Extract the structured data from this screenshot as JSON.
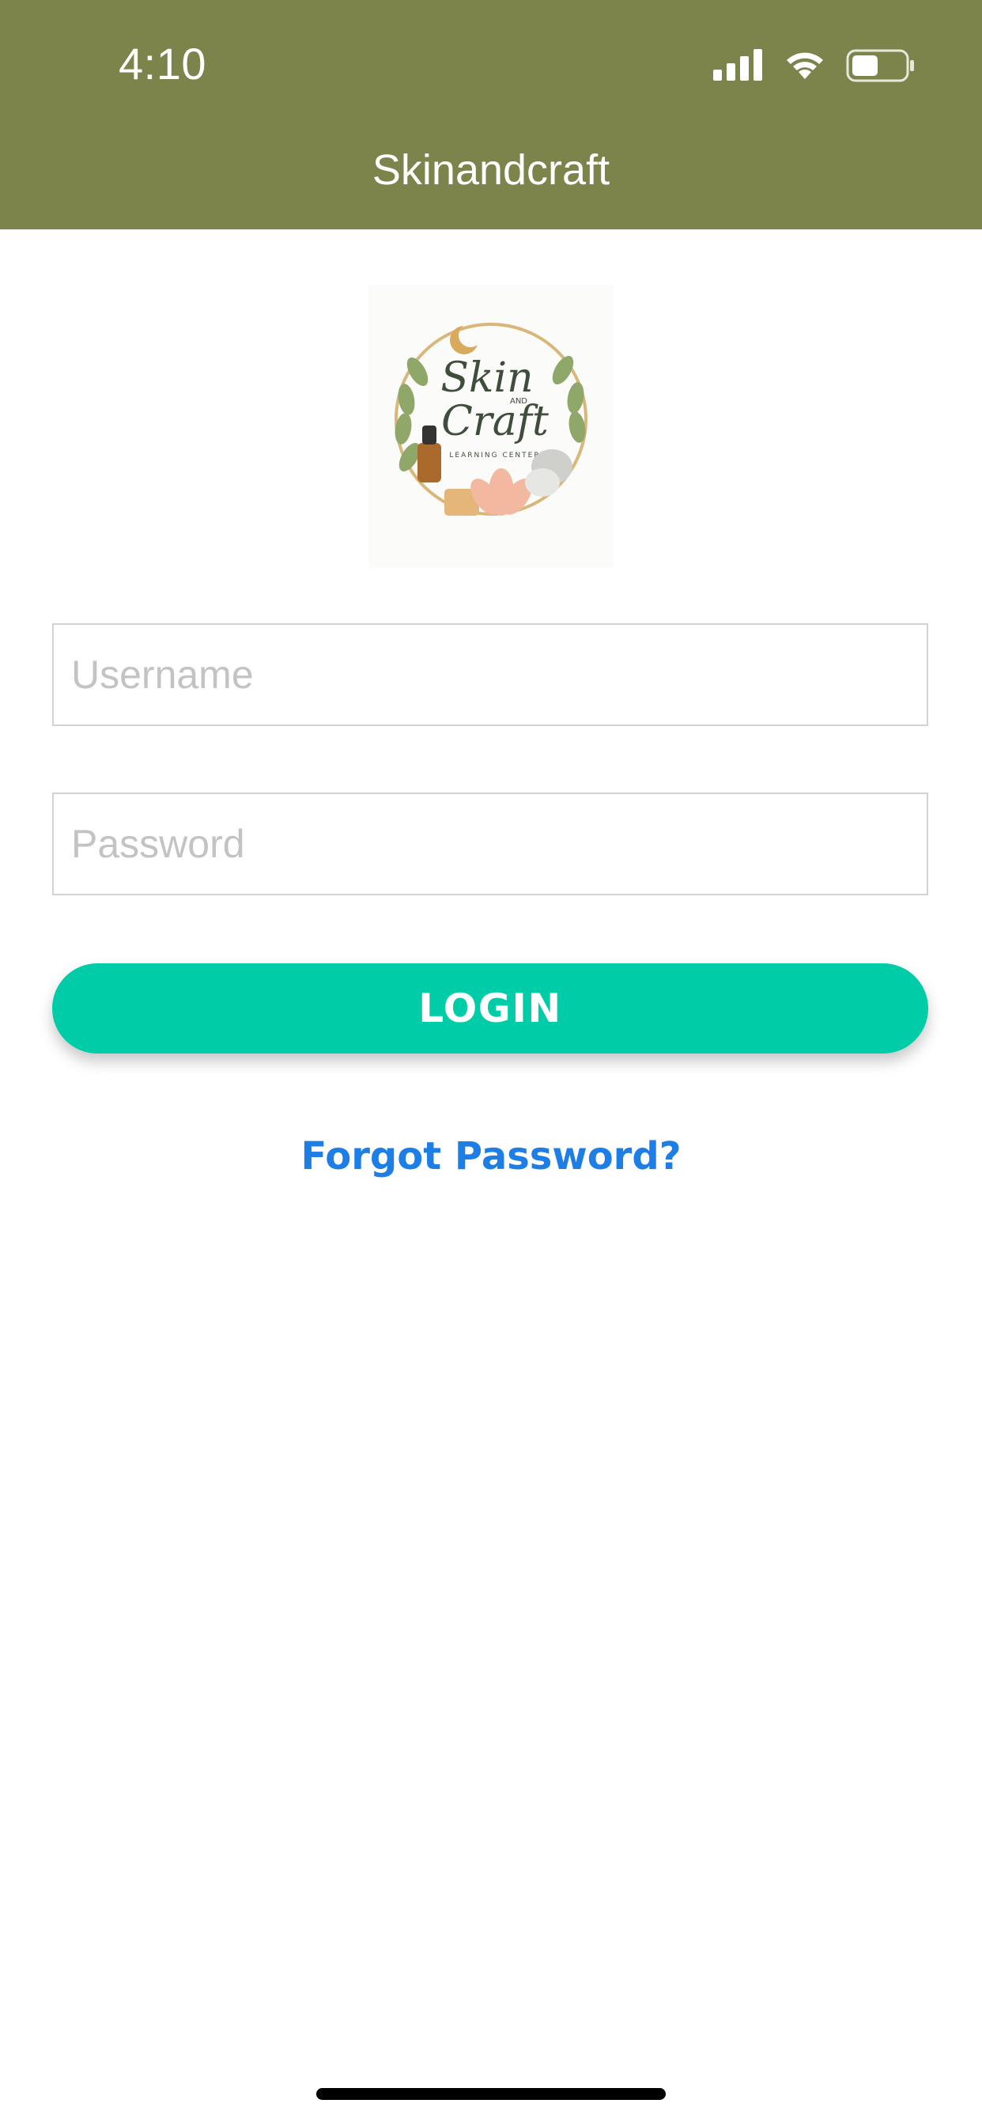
{
  "status_bar": {
    "time": "4:10",
    "icons": [
      "signal-icon",
      "wifi-icon",
      "battery-icon"
    ]
  },
  "header": {
    "title": "Skinandcraft",
    "background_color": "#7c844c"
  },
  "logo": {
    "text_main": "Skin",
    "text_and": "AND",
    "text_second": "Craft",
    "text_sub": "LEARNING CENTER"
  },
  "form": {
    "username_placeholder": "Username",
    "password_placeholder": "Password",
    "login_label": "LOGIN",
    "login_color": "#00cca7",
    "forgot_label": "Forgot Password?",
    "forgot_color": "#1d7ee6"
  }
}
